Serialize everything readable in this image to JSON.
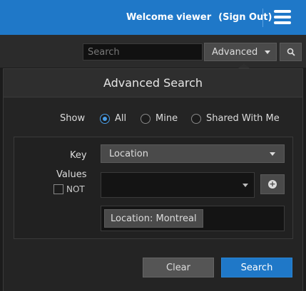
{
  "header": {
    "welcome_text": "Welcome",
    "user_name": "viewer",
    "sign_out_label": "(Sign Out)",
    "menu_icon": "hamburger-menu-icon",
    "accent_color": "#1f78c8"
  },
  "search_bar": {
    "placeholder": "Search",
    "value": "",
    "advanced_label": "Advanced",
    "search_icon": "magnifier-icon"
  },
  "advanced_search": {
    "title": "Advanced Search",
    "show_label": "Show",
    "show_options": [
      {
        "label": "All",
        "selected": true
      },
      {
        "label": "Mine",
        "selected": false
      },
      {
        "label": "Shared With Me",
        "selected": false
      }
    ],
    "key_label": "Key",
    "key_value": "Location",
    "values_label": "Values",
    "not_label": "NOT",
    "not_checked": false,
    "values_selected": "",
    "add_icon": "plus-circle-icon",
    "tags": [
      "Location: Montreal"
    ],
    "clear_label": "Clear",
    "search_label": "Search"
  }
}
